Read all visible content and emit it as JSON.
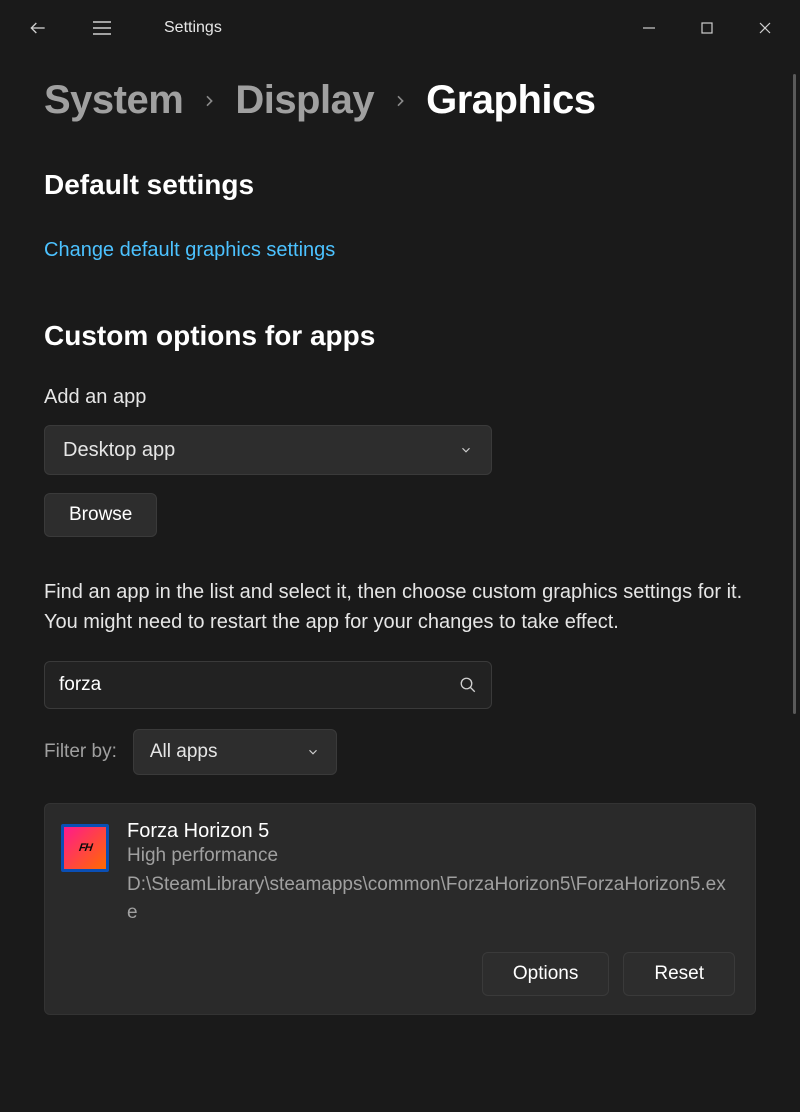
{
  "titlebar": {
    "title": "Settings"
  },
  "breadcrumb": {
    "items": [
      "System",
      "Display",
      "Graphics"
    ]
  },
  "sections": {
    "default": {
      "title": "Default settings",
      "link": "Change default graphics settings"
    },
    "custom": {
      "title": "Custom options for apps",
      "add_label": "Add an app",
      "app_type_selected": "Desktop app",
      "browse_label": "Browse",
      "description": "Find an app in the list and select it, then choose custom graphics settings for it. You might need to restart the app for your changes to take effect.",
      "search_value": "forza",
      "filter_label": "Filter by:",
      "filter_selected": "All apps"
    }
  },
  "apps": [
    {
      "name": "Forza Horizon 5",
      "performance": "High performance",
      "path": "D:\\SteamLibrary\\steamapps\\common\\ForzaHorizon5\\ForzaHorizon5.exe",
      "icon_text": "FH"
    }
  ],
  "buttons": {
    "options": "Options",
    "reset": "Reset"
  }
}
